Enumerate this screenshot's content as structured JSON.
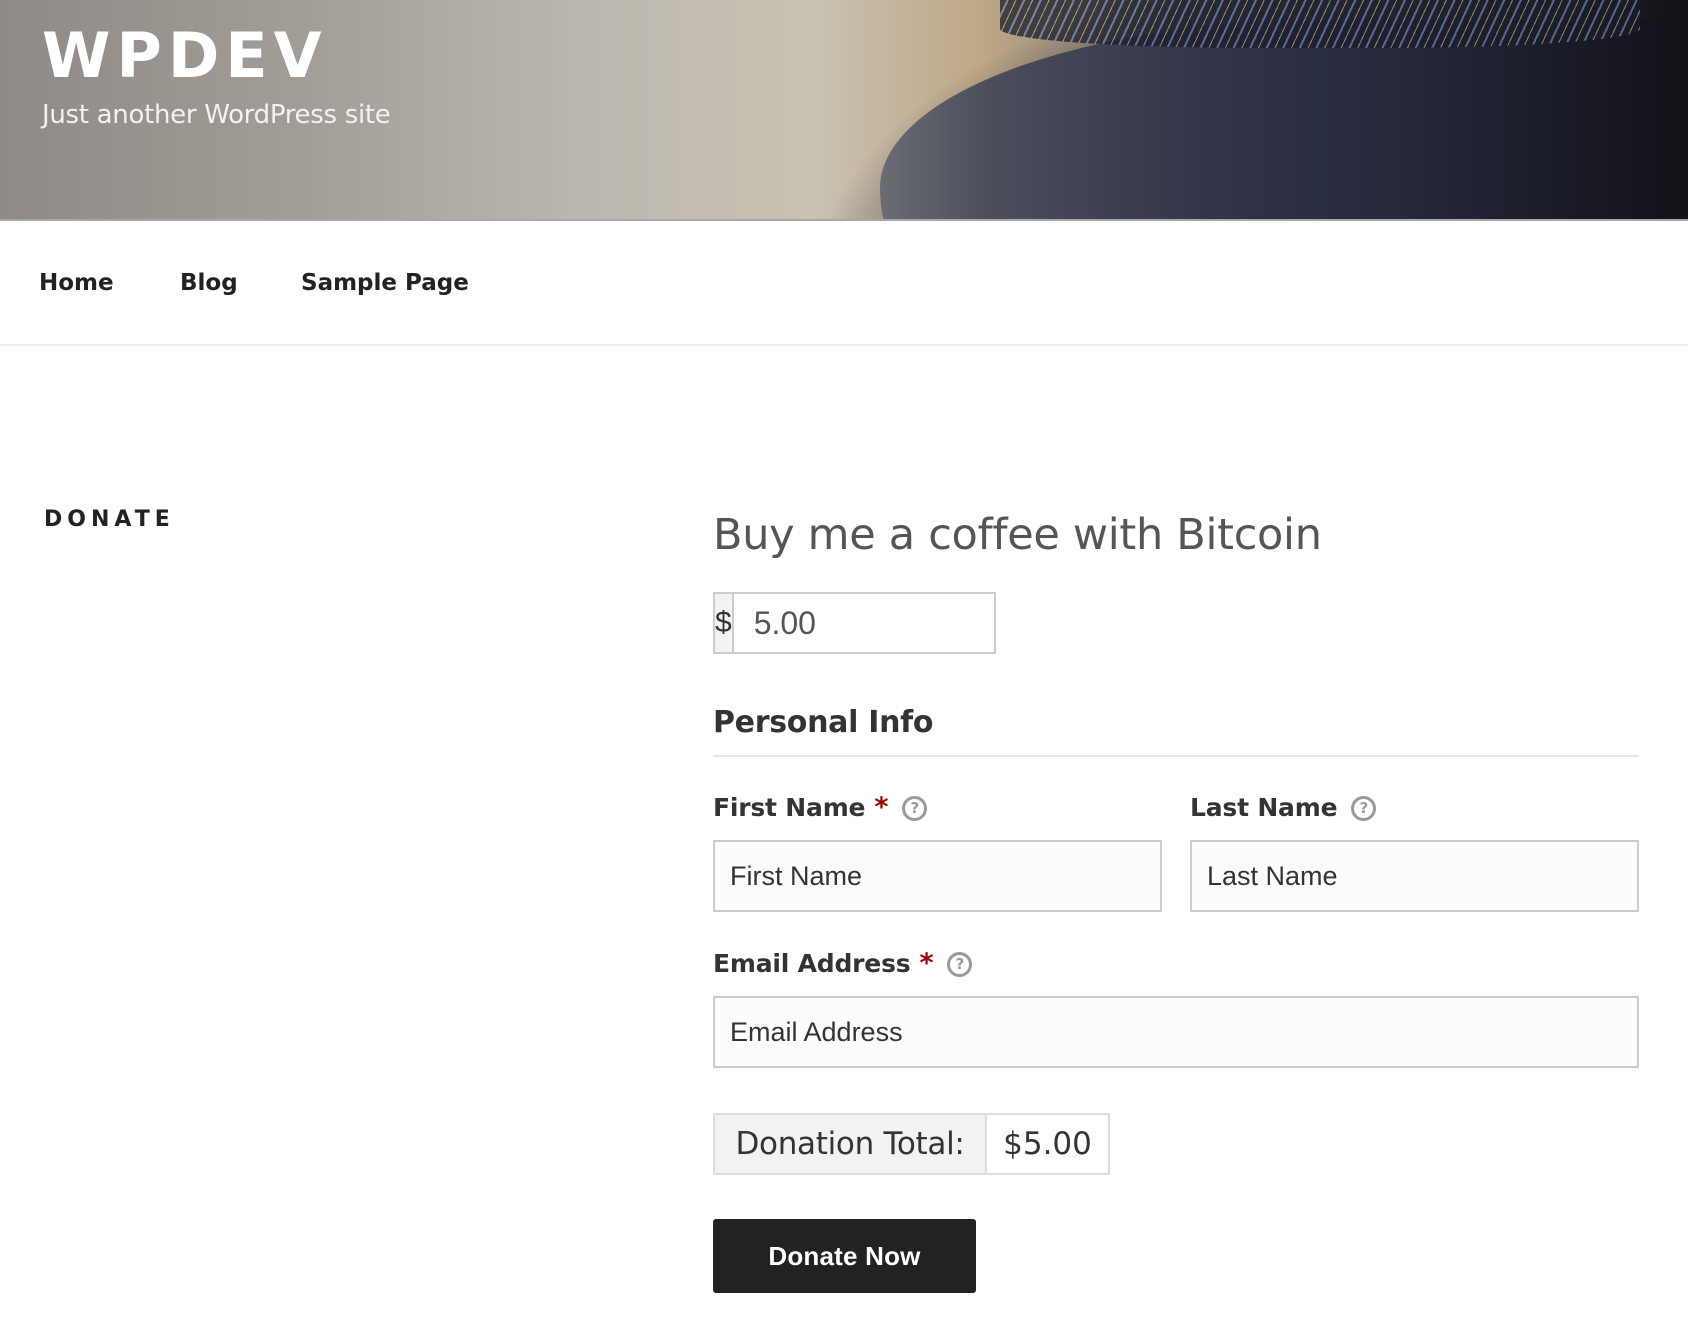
{
  "header": {
    "site_title": "WPDEV",
    "tagline": "Just another WordPress site"
  },
  "nav": {
    "items": [
      {
        "label": "Home"
      },
      {
        "label": "Blog"
      },
      {
        "label": "Sample Page"
      }
    ]
  },
  "sidebar": {
    "heading": "DONATE"
  },
  "form": {
    "title": "Buy me a coffee with Bitcoin",
    "amount": {
      "currency_symbol": "$",
      "value": "5.00"
    },
    "section_title": "Personal Info",
    "fields": {
      "first_name": {
        "label": "First Name",
        "required": "*",
        "help_icon": "question-circle-icon",
        "placeholder": "First Name",
        "value": ""
      },
      "last_name": {
        "label": "Last Name",
        "help_icon": "question-circle-icon",
        "placeholder": "Last Name",
        "value": ""
      },
      "email": {
        "label": "Email Address",
        "required": "*",
        "help_icon": "question-circle-icon",
        "placeholder": "Email Address",
        "value": ""
      }
    },
    "help_glyph": "?",
    "total": {
      "label": "Donation Total:",
      "amount": "$5.00"
    },
    "submit_label": "Donate Now"
  },
  "colors": {
    "required": "#a30000",
    "button_bg": "#222222",
    "addon_bg": "#f2f2f2",
    "border": "#cccccc"
  }
}
